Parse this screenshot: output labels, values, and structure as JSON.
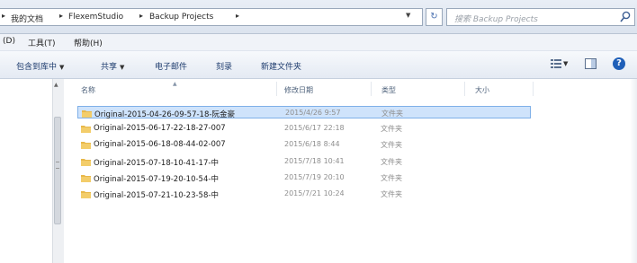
{
  "address_bar": {
    "crumbs": [
      "我的文档",
      "FlexemStudio",
      "Backup Projects"
    ],
    "search_placeholder": "搜索 Backup Projects"
  },
  "menu": {
    "items": [
      "(D)",
      "工具(T)",
      "帮助(H)"
    ]
  },
  "command_bar": {
    "items": [
      "包含到库中",
      "共享",
      "电子邮件",
      "刻录",
      "新建文件夹"
    ]
  },
  "columns": {
    "name": "名称",
    "date": "修改日期",
    "type": "类型",
    "size": "大小"
  },
  "files": [
    {
      "name": "Original-2015-04-26-09-57-18-阮金豪",
      "date": "2015/4/26 9:57",
      "type": "文件夹",
      "selected": true
    },
    {
      "name": "Original-2015-06-17-22-18-27-007",
      "date": "2015/6/17 22:18",
      "type": "文件夹",
      "selected": false
    },
    {
      "name": "Original-2015-06-18-08-44-02-007",
      "date": "2015/6/18 8:44",
      "type": "文件夹",
      "selected": false
    },
    {
      "name": "Original-2015-07-18-10-41-17-中",
      "date": "2015/7/18 10:41",
      "type": "文件夹",
      "selected": false
    },
    {
      "name": "Original-2015-07-19-20-10-54-中",
      "date": "2015/7/19 20:10",
      "type": "文件夹",
      "selected": false
    },
    {
      "name": "Original-2015-07-21-10-23-58-中",
      "date": "2015/7/21 10:24",
      "type": "文件夹",
      "selected": false
    }
  ],
  "icons": {
    "breadcrumb_separator": "chevron-right-icon",
    "search": "search-icon",
    "refresh": "refresh-icon",
    "folder": "folder-icon",
    "view": "view-options-icon",
    "preview": "preview-pane-icon",
    "help": "help-icon"
  },
  "colors": {
    "selection_bg": "#cfe3fb",
    "selection_border": "#7fb0e8",
    "folder": "#e8b84a",
    "help": "#1f5fb8"
  }
}
